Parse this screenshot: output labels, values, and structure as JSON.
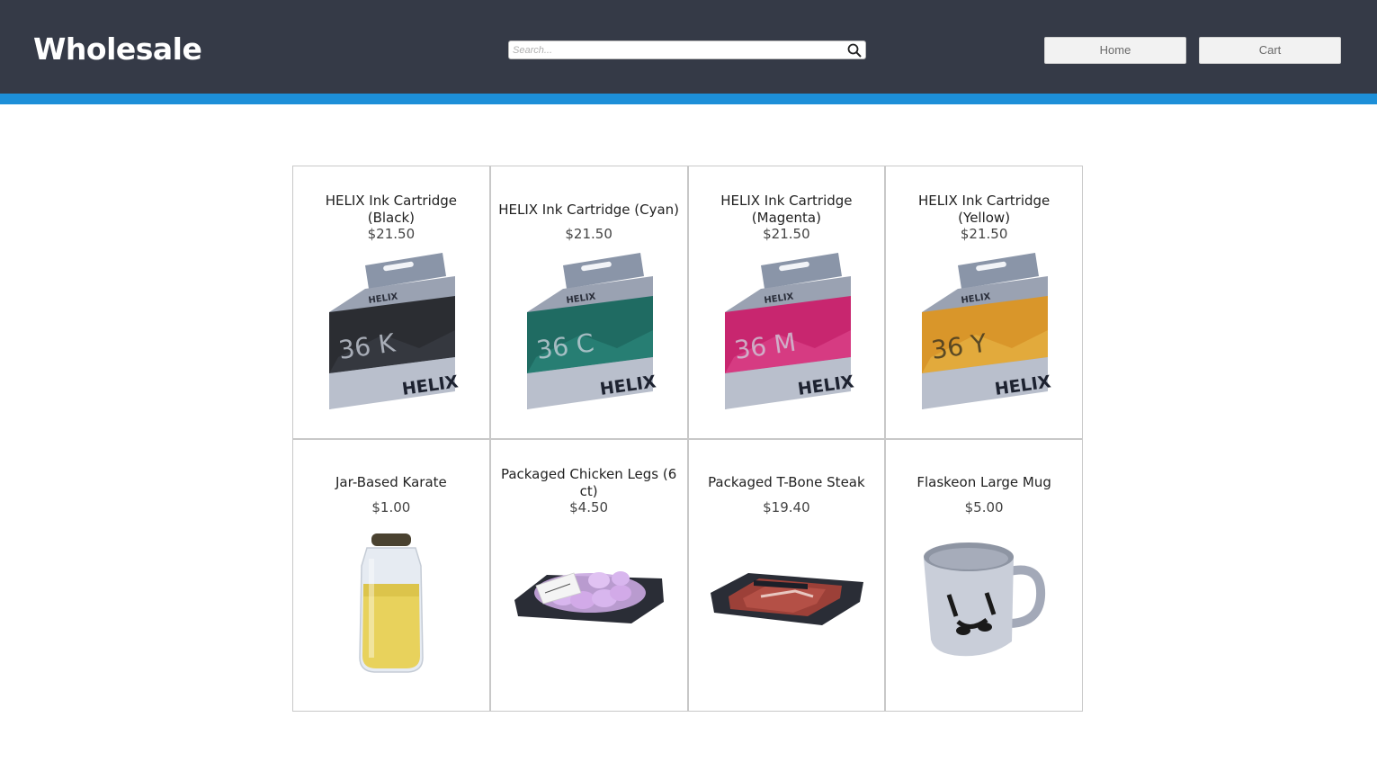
{
  "brand": "Wholesale",
  "search": {
    "placeholder": "Search..."
  },
  "nav": {
    "home_label": "Home",
    "cart_label": "Cart"
  },
  "colors": {
    "header_bg": "#353a47",
    "accent": "#1d8fd8"
  },
  "products": [
    {
      "name": "HELIX Ink Cartridge (Black)",
      "price": "$21.50",
      "image": "ink-box-black",
      "box_code": "36 K",
      "box_brand": "HELIX",
      "color": "#2b2d32"
    },
    {
      "name": "HELIX Ink Cartridge (Cyan)",
      "price": "$21.50",
      "image": "ink-box-cyan",
      "box_code": "36 C",
      "box_brand": "HELIX",
      "color": "#1f6b62"
    },
    {
      "name": "HELIX Ink Cartridge (Magenta)",
      "price": "$21.50",
      "image": "ink-box-magenta",
      "box_code": "36 M",
      "box_brand": "HELIX",
      "color": "#c8266f"
    },
    {
      "name": "HELIX Ink Cartridge (Yellow)",
      "price": "$21.50",
      "image": "ink-box-yellow",
      "box_code": "36 Y",
      "box_brand": "HELIX",
      "color": "#d9962a"
    },
    {
      "name": "Jar-Based Karate",
      "price": "$1.00",
      "image": "jar"
    },
    {
      "name": "Packaged Chicken Legs (6 ct)",
      "price": "$4.50",
      "image": "chicken-pack"
    },
    {
      "name": "Packaged T-Bone Steak",
      "price": "$19.40",
      "image": "steak-pack"
    },
    {
      "name": "Flaskeon Large Mug",
      "price": "$5.00",
      "image": "mug"
    }
  ]
}
